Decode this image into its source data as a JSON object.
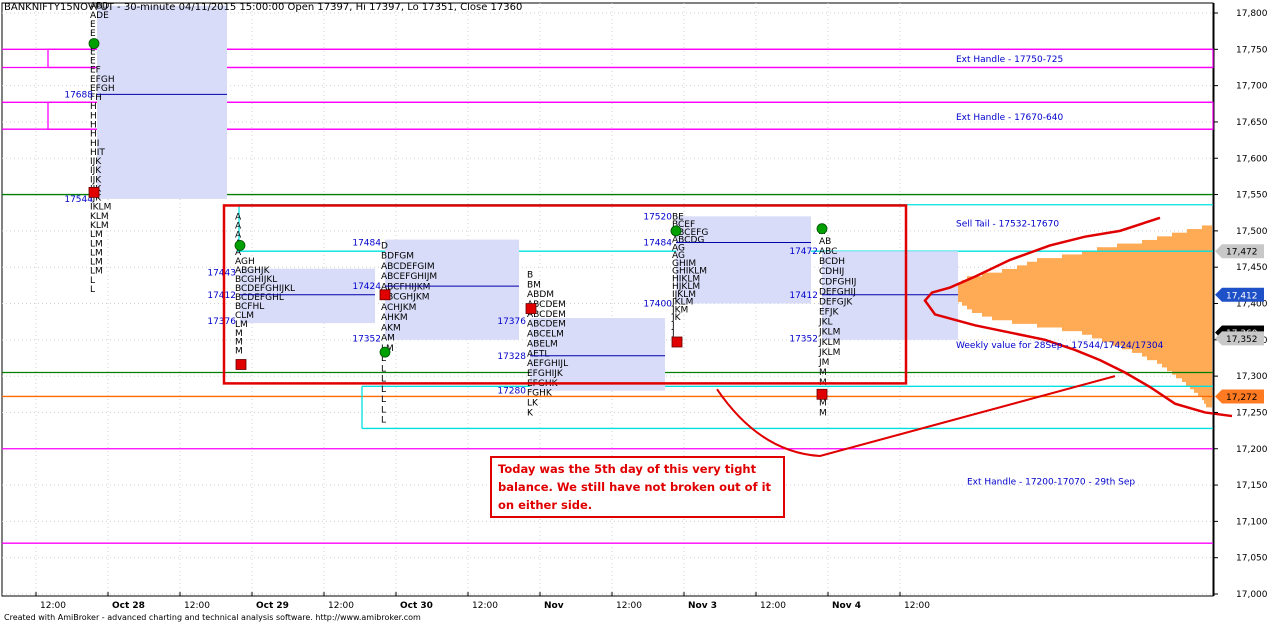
{
  "header": {
    "title": "BANKNIFTY15NOVFUT - 30-minute 04/11/2015 15:00:00 Open 17397, Hi 17397, Lo 17351, Close 17360"
  },
  "footer": {
    "text": "Created with AmiBroker - advanced charting and technical analysis software. http://www.amibroker.com"
  },
  "colors": {
    "handle": "#ff00ff",
    "green_level": "#008000",
    "cyan_level": "#00e0e0",
    "orange_level": "#ff6a00",
    "value_area": "#d8dcf8",
    "profile": "#ffaa55",
    "annotation_red": "#e00000",
    "label_blue": "#0000cc",
    "marker_red": "#e00000",
    "marker_green": "#00a000"
  },
  "chart_data": {
    "type": "market-profile",
    "ylim": [
      16990,
      17820
    ],
    "y_ticks": [
      17000,
      17050,
      17100,
      17150,
      17200,
      17250,
      17300,
      17350,
      17400,
      17450,
      17500,
      17550,
      17600,
      17650,
      17700,
      17750,
      17800
    ],
    "y_tick_labels": [
      "17,000",
      "17,050",
      "17,100",
      "17,150",
      "17,200",
      "17,250",
      "17,300",
      "17,350",
      "17,400",
      "17,450",
      "17,500",
      "17,550",
      "17,600",
      "17,650",
      "17,700",
      "17,750",
      "17,800"
    ],
    "x_labels": [
      {
        "text": "12:00",
        "slot": 0.5
      },
      {
        "text": "Oct 28",
        "slot": 1.5
      },
      {
        "text": "12:00",
        "slot": 2.5
      },
      {
        "text": "Oct 29",
        "slot": 3.5
      },
      {
        "text": "12:00",
        "slot": 4.5
      },
      {
        "text": "Oct 30",
        "slot": 5.5
      },
      {
        "text": "12:00",
        "slot": 6.5
      },
      {
        "text": "Nov",
        "slot": 7.5
      },
      {
        "text": "12:00",
        "slot": 8.5
      },
      {
        "text": "Nov 3",
        "slot": 9.5
      },
      {
        "text": "12:00",
        "slot": 10.5
      },
      {
        "text": "Nov 4",
        "slot": 11.5
      },
      {
        "text": "12:00",
        "slot": 12.5
      }
    ],
    "price_badges": [
      {
        "value": 17472,
        "label": "17,472",
        "style": "gray"
      },
      {
        "value": 17412,
        "label": "17,412",
        "style": "blue"
      },
      {
        "value": 17360,
        "label": "17,360",
        "style": "black"
      },
      {
        "value": 17352,
        "label": "17,352",
        "style": "gray"
      },
      {
        "value": 17272,
        "label": "17,272",
        "style": "orange"
      }
    ],
    "horizontal_levels": [
      {
        "name": "ext-handle-top-upper",
        "value": 17750,
        "color": "handle"
      },
      {
        "name": "ext-handle-top-lower",
        "value": 17725,
        "color": "handle"
      },
      {
        "name": "ext-handle-mid-upper",
        "value": 17677,
        "color": "handle"
      },
      {
        "name": "ext-handle-mid-lower",
        "value": 17640,
        "color": "handle"
      },
      {
        "name": "green-upper",
        "value": 17550,
        "color": "green_level"
      },
      {
        "name": "green-lower",
        "value": 17305,
        "color": "green_level"
      },
      {
        "name": "orange-close-level",
        "value": 17272,
        "color": "orange_level"
      },
      {
        "name": "magenta-200",
        "value": 17200,
        "color": "handle"
      },
      {
        "name": "magenta-070",
        "value": 17070,
        "color": "handle"
      }
    ],
    "profiles": [
      {
        "day": "Oct 28",
        "poc": 17688,
        "val": 17544,
        "vah": 17790,
        "labels": [
          {
            "text": "17688",
            "value": 17688
          },
          {
            "text": "17544",
            "value": 17544
          }
        ]
      },
      {
        "day": "Oct 29",
        "poc": 17412,
        "val": 17376,
        "vah": 17443,
        "labels": [
          {
            "text": "17443",
            "value": 17443
          },
          {
            "text": "17412",
            "value": 17412
          },
          {
            "text": "17376",
            "value": 17376
          }
        ]
      },
      {
        "day": "Oct 30",
        "poc": 17424,
        "val": 17352,
        "vah": 17484,
        "labels": [
          {
            "text": "17484",
            "value": 17484
          },
          {
            "text": "17424",
            "value": 17424
          },
          {
            "text": "17352",
            "value": 17352
          }
        ]
      },
      {
        "day": "Nov 2",
        "poc": 17328,
        "val": 17280,
        "vah": 17376,
        "labels": [
          {
            "text": "17376",
            "value": 17376
          },
          {
            "text": "17328",
            "value": 17328
          },
          {
            "text": "17280",
            "value": 17280
          }
        ]
      },
      {
        "day": "Nov 3",
        "poc": 17484,
        "val": 17400,
        "vah": 17520,
        "labels": [
          {
            "text": "17520",
            "value": 17520
          },
          {
            "text": "17484",
            "value": 17484
          },
          {
            "text": "17400",
            "value": 17400
          }
        ]
      },
      {
        "day": "Nov 4",
        "poc": 17412,
        "val": 17352,
        "vah": 17472,
        "labels": [
          {
            "text": "17472",
            "value": 17472
          },
          {
            "text": "17412",
            "value": 17412
          },
          {
            "text": "17352",
            "value": 17352
          }
        ]
      }
    ],
    "annotations": [
      {
        "text": "Ext Handle - 17750-725",
        "value": 17737
      },
      {
        "text": "Ext Handle - 17670-640",
        "value": 17657
      },
      {
        "text": "Sell Tail - 17532-17670",
        "value": 17510
      },
      {
        "text": "Weekly value for 28Sep - 17544/17424/17304",
        "value": 17343
      },
      {
        "text": "Ext Handle - 17200-17070 - 29th Sep",
        "value": 17155
      }
    ],
    "note_box": {
      "lines": [
        "Today was the 5th day of this very tight",
        "balance. We still have not broken out of it",
        "on either side."
      ]
    }
  }
}
